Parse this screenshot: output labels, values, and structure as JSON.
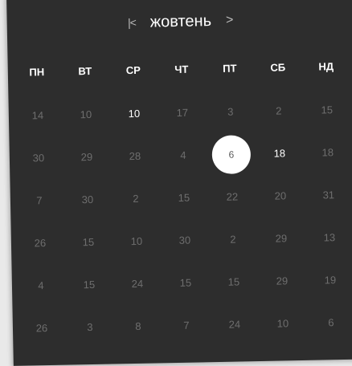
{
  "calendar": {
    "month_label": "жовтень",
    "nav_first_icon": "first-page-icon",
    "nav_prev_icon": "chevron-left-icon",
    "nav_next_icon": "chevron-right-icon",
    "nav_first_glyph": "|<",
    "nav_prev_glyph": "<",
    "nav_next_glyph": ">",
    "weekdays": [
      "ПН",
      "ВТ",
      "СР",
      "ЧТ",
      "ПТ",
      "СБ",
      "НД"
    ],
    "selected_day": "6",
    "weeks": [
      [
        {
          "v": "14",
          "s": "muted"
        },
        {
          "v": "10",
          "s": "muted"
        },
        {
          "v": "10",
          "s": "active"
        },
        {
          "v": "17",
          "s": "muted"
        },
        {
          "v": "3",
          "s": "muted"
        },
        {
          "v": "2",
          "s": "muted"
        },
        {
          "v": "15",
          "s": "muted"
        }
      ],
      [
        {
          "v": "30",
          "s": "muted"
        },
        {
          "v": "29",
          "s": "muted"
        },
        {
          "v": "28",
          "s": "muted"
        },
        {
          "v": "4",
          "s": "muted"
        },
        {
          "v": "6",
          "s": "selected"
        },
        {
          "v": "18",
          "s": "active"
        },
        {
          "v": "18",
          "s": "muted"
        }
      ],
      [
        {
          "v": "7",
          "s": "muted"
        },
        {
          "v": "30",
          "s": "muted"
        },
        {
          "v": "2",
          "s": "muted"
        },
        {
          "v": "15",
          "s": "muted"
        },
        {
          "v": "22",
          "s": "muted"
        },
        {
          "v": "20",
          "s": "muted"
        },
        {
          "v": "31",
          "s": "muted"
        }
      ],
      [
        {
          "v": "26",
          "s": "muted"
        },
        {
          "v": "15",
          "s": "muted"
        },
        {
          "v": "10",
          "s": "muted"
        },
        {
          "v": "30",
          "s": "muted"
        },
        {
          "v": "2",
          "s": "muted"
        },
        {
          "v": "29",
          "s": "muted"
        },
        {
          "v": "13",
          "s": "muted"
        }
      ],
      [
        {
          "v": "4",
          "s": "muted"
        },
        {
          "v": "15",
          "s": "muted"
        },
        {
          "v": "24",
          "s": "muted"
        },
        {
          "v": "15",
          "s": "muted"
        },
        {
          "v": "15",
          "s": "muted"
        },
        {
          "v": "29",
          "s": "muted"
        },
        {
          "v": "19",
          "s": "muted"
        }
      ],
      [
        {
          "v": "26",
          "s": "muted"
        },
        {
          "v": "3",
          "s": "muted"
        },
        {
          "v": "8",
          "s": "muted"
        },
        {
          "v": "7",
          "s": "muted"
        },
        {
          "v": "24",
          "s": "muted"
        },
        {
          "v": "10",
          "s": "muted"
        },
        {
          "v": "6",
          "s": "muted"
        }
      ]
    ]
  },
  "colors": {
    "background": "#2d2d2d",
    "text_active": "#ffffff",
    "text_muted": "#6e6e6e",
    "selected_fill": "#ffffff"
  }
}
